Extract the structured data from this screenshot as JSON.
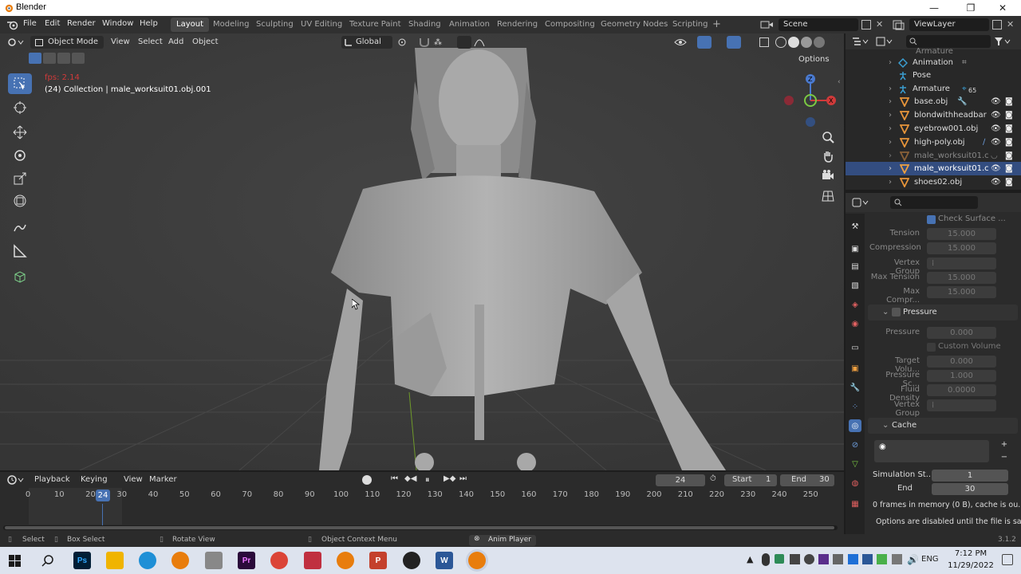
{
  "window": {
    "title": "Blender",
    "minimize": "—",
    "maximize": "❐",
    "close": "✕"
  },
  "menu": {
    "items": [
      "File",
      "Edit",
      "Render",
      "Window",
      "Help"
    ]
  },
  "workspaces": {
    "tabs": [
      "Layout",
      "Modeling",
      "Sculpting",
      "UV Editing",
      "Texture Paint",
      "Shading",
      "Animation",
      "Rendering",
      "Compositing",
      "Geometry Nodes",
      "Scripting"
    ],
    "active": "Layout",
    "add_label": "+"
  },
  "scene": {
    "label": "Scene",
    "view_layer": "ViewLayer"
  },
  "viewport": {
    "mode": "Object Mode",
    "menus": [
      "View",
      "Select",
      "Add",
      "Object"
    ],
    "orientation": "Global",
    "options": "Options",
    "fps": "fps: 2.14",
    "collection": "(24) Collection | male_worksuit01.obj.001"
  },
  "outliner": {
    "rows": [
      {
        "label": "Armature",
        "icon": "armature-data-icon",
        "dim": false,
        "selected": false
      },
      {
        "label": "Animation",
        "icon": "animation-icon",
        "dim": false,
        "selected": false
      },
      {
        "label": "Pose",
        "icon": "pose-icon",
        "dim": false,
        "selected": false
      },
      {
        "label": "Armature",
        "icon": "armature-icon",
        "dim": false,
        "selected": false,
        "badge": "65"
      },
      {
        "label": "base.obj",
        "icon": "mesh-icon",
        "dim": false,
        "selected": false
      },
      {
        "label": "blondwithheadbar",
        "icon": "mesh-icon",
        "dim": false,
        "selected": false
      },
      {
        "label": "eyebrow001.obj",
        "icon": "mesh-icon",
        "dim": false,
        "selected": false
      },
      {
        "label": "high-poly.obj",
        "icon": "mesh-icon",
        "dim": false,
        "selected": false
      },
      {
        "label": "male_worksuit01.c",
        "icon": "mesh-icon",
        "dim": true,
        "selected": false
      },
      {
        "label": "male_worksuit01.c",
        "icon": "mesh-icon",
        "dim": false,
        "selected": true
      },
      {
        "label": "shoes02.obj",
        "icon": "mesh-icon",
        "dim": false,
        "selected": false
      }
    ]
  },
  "properties": {
    "check_surface": "Check Surface ...",
    "tension": {
      "label": "Tension",
      "value": "15.000"
    },
    "compression": {
      "label": "Compression",
      "value": "15.000"
    },
    "vertex_group": "Vertex Group",
    "max_tension": {
      "label": "Max Tension",
      "value": "15.000"
    },
    "max_compression": {
      "label": "Max Compr...",
      "value": "15.000"
    },
    "pressure_header": "Pressure",
    "pressure": {
      "label": "Pressure",
      "value": "0.000"
    },
    "custom_volume": "Custom Volume",
    "target_volume": {
      "label": "Target Volu...",
      "value": "0.000"
    },
    "pressure_scale": {
      "label": "Pressure Sc...",
      "value": "1.000"
    },
    "fluid_density": {
      "label": "Fluid Density",
      "value": "0.0000"
    },
    "vertex_group2": "Vertex Group",
    "cache_header": "Cache",
    "simulation_start": {
      "label": "Simulation St...",
      "value": "1"
    },
    "end": {
      "label": "End",
      "value": "30"
    },
    "memory_info": "0 frames in memory (0 B), cache is ou...",
    "options_info": "Options are disabled until the file is sa..."
  },
  "timeline": {
    "menus": [
      "Playback",
      "Keying",
      "View",
      "Marker"
    ],
    "current_frame": "24",
    "start_label": "Start",
    "start": "1",
    "end_label": "End",
    "end": "30",
    "ticks": [
      "0",
      "10",
      "20",
      "30",
      "40",
      "50",
      "60",
      "70",
      "80",
      "90",
      "100",
      "110",
      "120",
      "130",
      "140",
      "150",
      "160",
      "170",
      "180",
      "190",
      "200",
      "210",
      "220",
      "230",
      "240",
      "250"
    ],
    "playhead": "24"
  },
  "status": {
    "select": "Select",
    "box_select": "Box Select",
    "rotate_view": "Rotate View",
    "context_menu": "Object Context Menu",
    "anim_player": "Anim Player",
    "version": "3.1.2"
  },
  "taskbar": {
    "apps": [
      "Ps",
      "Pr",
      "P",
      "W"
    ],
    "language": "ENG",
    "time": "7:12 PM",
    "date": "11/29/2022"
  }
}
